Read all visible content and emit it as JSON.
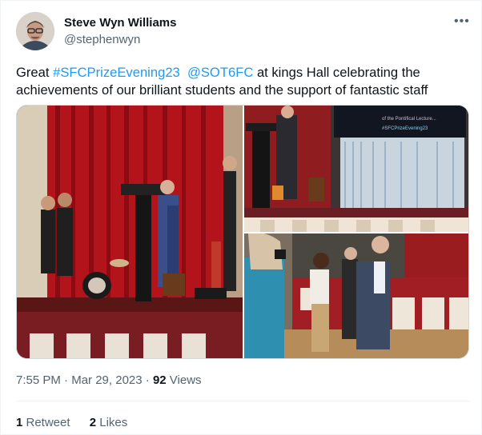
{
  "author": {
    "name": "Steve Wyn Williams",
    "handle": "@stephenwyn"
  },
  "more_icon": "more-horizontal-icon",
  "tweet": {
    "prefix": "Great ",
    "hashtag": "#SFCPrizeEvening23",
    "mention": "@SOT6FC",
    "suffix": " at kings Hall celebrating  the achievements of our brilliant students and the support of fantastic staff"
  },
  "media": {
    "photo2_screen_text": "#SFCPrizeEvening23"
  },
  "meta": {
    "time": "7:55 PM",
    "dot1": " · ",
    "date": "Mar 29, 2023",
    "dot2": " · ",
    "views_count": "92",
    "views_label": " Views"
  },
  "stats": {
    "retweets_count": "1",
    "retweets_label": " Retweet",
    "likes_count": "2",
    "likes_label": " Likes"
  },
  "colors": {
    "link": "#1d9bf0",
    "muted": "#536471",
    "text": "#0f1419"
  }
}
